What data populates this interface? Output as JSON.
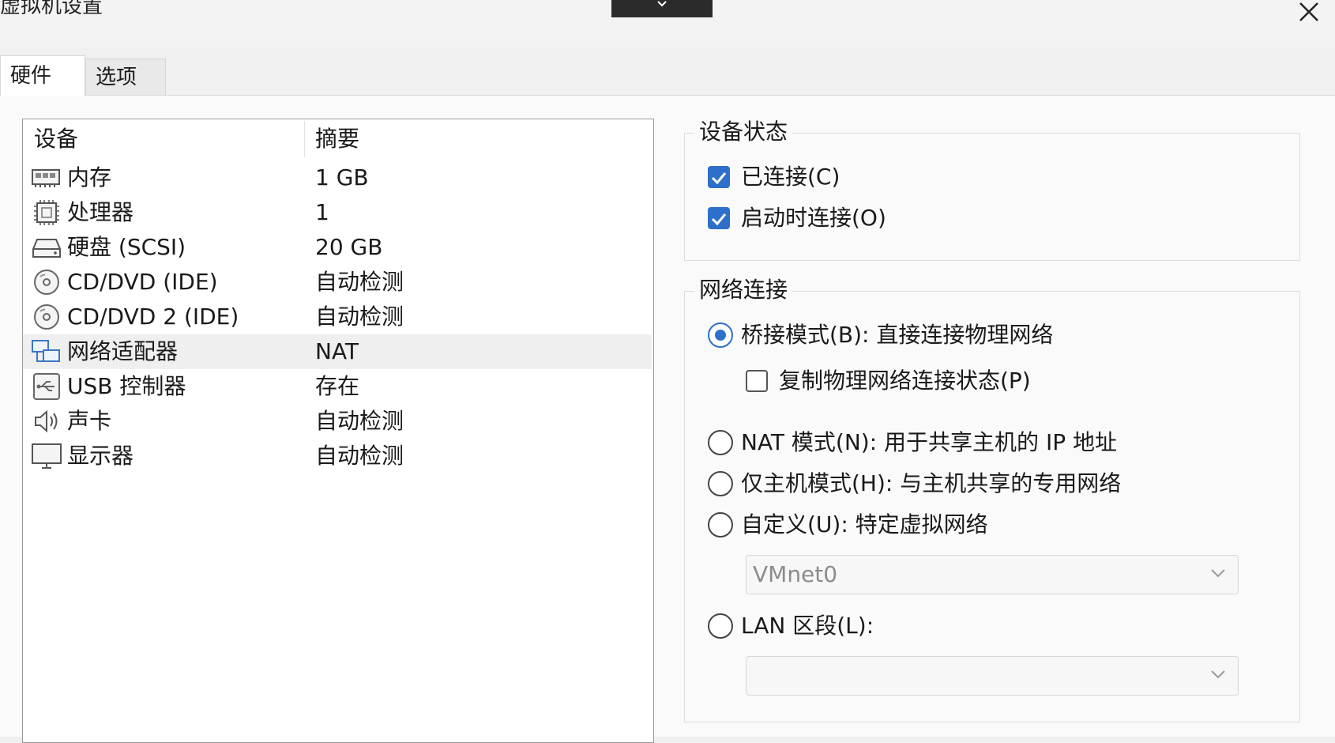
{
  "window": {
    "title": "虚拟机设置"
  },
  "tabs": [
    {
      "label": "硬件",
      "active": true
    },
    {
      "label": "选项",
      "active": false
    }
  ],
  "device_table": {
    "headers": {
      "device": "设备",
      "summary": "摘要"
    },
    "rows": [
      {
        "icon": "memory-icon",
        "name": "内存",
        "summary": "1 GB"
      },
      {
        "icon": "cpu-icon",
        "name": "处理器",
        "summary": "1"
      },
      {
        "icon": "hard-disk-icon",
        "name": "硬盘 (SCSI)",
        "summary": "20 GB"
      },
      {
        "icon": "cd-dvd-icon",
        "name": "CD/DVD (IDE)",
        "summary": "自动检测"
      },
      {
        "icon": "cd-dvd-icon",
        "name": "CD/DVD 2 (IDE)",
        "summary": "自动检测"
      },
      {
        "icon": "network-adapter-icon",
        "name": "网络适配器",
        "summary": "NAT",
        "selected": true
      },
      {
        "icon": "usb-icon",
        "name": "USB 控制器",
        "summary": "存在"
      },
      {
        "icon": "speaker-icon",
        "name": "声卡",
        "summary": "自动检测"
      },
      {
        "icon": "monitor-icon",
        "name": "显示器",
        "summary": "自动检测"
      }
    ]
  },
  "device_status": {
    "title": "设备状态",
    "connected": {
      "label": "已连接(C)",
      "checked": true
    },
    "connect_at_power_on": {
      "label": "启动时连接(O)",
      "checked": true
    }
  },
  "network": {
    "title": "网络连接",
    "bridged": {
      "label": "桥接模式(B): 直接连接物理网络",
      "selected": true
    },
    "replicate": {
      "label": "复制物理网络连接状态(P)",
      "checked": false
    },
    "nat": {
      "label": "NAT 模式(N): 用于共享主机的 IP 地址",
      "selected": false
    },
    "host_only": {
      "label": "仅主机模式(H): 与主机共享的专用网络",
      "selected": false
    },
    "custom": {
      "label": "自定义(U): 特定虚拟网络",
      "selected": false,
      "value": "VMnet0"
    },
    "lan_segment": {
      "label": "LAN 区段(L):",
      "selected": false,
      "value": ""
    }
  },
  "colors": {
    "accent": "#2e6fc9",
    "selected_row": "#efefef"
  }
}
